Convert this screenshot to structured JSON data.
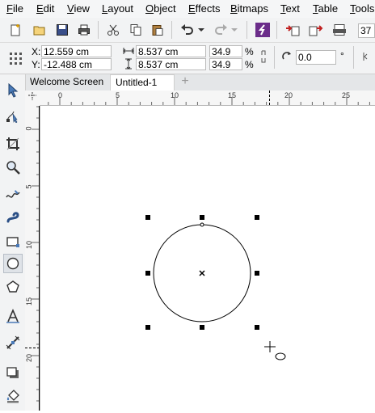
{
  "menu": [
    {
      "id": "file",
      "label": "File"
    },
    {
      "id": "edit",
      "label": "Edit"
    },
    {
      "id": "view",
      "label": "View"
    },
    {
      "id": "layout",
      "label": "Layout"
    },
    {
      "id": "object",
      "label": "Object"
    },
    {
      "id": "effects",
      "label": "Effects"
    },
    {
      "id": "bitmaps",
      "label": "Bitmaps"
    },
    {
      "id": "text",
      "label": "Text"
    },
    {
      "id": "table",
      "label": "Table"
    },
    {
      "id": "tools",
      "label": "Tools"
    }
  ],
  "toolbar": {
    "zoom_value": "37",
    "icons": [
      "new-document-icon",
      "open-icon",
      "save-icon",
      "print-icon",
      "cut-icon",
      "copy-icon",
      "paste-icon",
      "undo-icon",
      "redo-icon",
      "app-launcher-icon",
      "import-icon",
      "export-icon",
      "publish-pdf-icon"
    ]
  },
  "property_bar": {
    "x_label": "X:",
    "x_value": "12.559 cm",
    "y_label": "Y:",
    "y_value": "-12.488 cm",
    "width_value": "8.537 cm",
    "height_value": "8.537 cm",
    "scale_x": "34.9",
    "scale_y": "34.9",
    "percent_symbol": "%",
    "rotation_value": "0.0",
    "degree_symbol": "°"
  },
  "tabs": [
    {
      "id": "welcome",
      "label": "Welcome Screen",
      "active": false
    },
    {
      "id": "untitled",
      "label": "Untitled-1",
      "active": true
    }
  ],
  "add_tab_symbol": "+",
  "hruler_labels": [
    "0",
    "5",
    "10",
    "15",
    "20",
    "25"
  ],
  "vruler_labels": [
    "0",
    "5",
    "10",
    "15",
    "20"
  ],
  "tools": [
    "pick-tool-icon",
    "shape-tool-icon",
    "crop-tool-icon",
    "zoom-tool-icon",
    "freehand-tool-icon",
    "artistic-media-icon",
    "rectangle-tool-icon",
    "ellipse-tool-icon",
    "polygon-tool-icon",
    "text-tool-icon",
    "parallel-dimension-icon",
    "drop-shadow-icon",
    "fill-tool-icon"
  ],
  "colors": {
    "chrome": "#f2f3f4",
    "accent": "#6b2d8a",
    "selection": "#000000"
  }
}
